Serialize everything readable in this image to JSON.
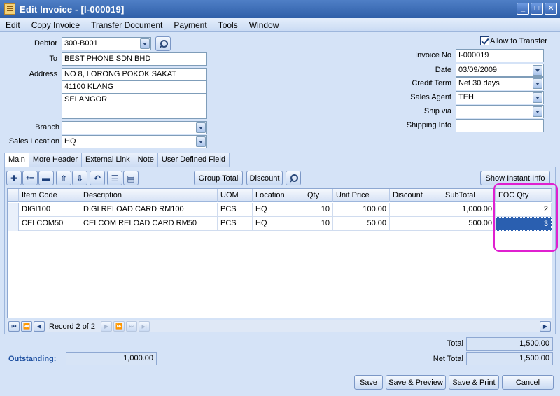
{
  "window": {
    "title": "Edit Invoice - [I-000019]",
    "controls": {
      "minimize": "_",
      "maximize": "□",
      "close": "✕"
    }
  },
  "menu": [
    "Edit",
    "Copy Invoice",
    "Transfer Document",
    "Payment",
    "Tools",
    "Window"
  ],
  "header": {
    "debtor_label": "Debtor",
    "debtor_value": "300-B001",
    "to_label": "To",
    "to_value": "BEST PHONE SDN BHD",
    "address_label": "Address",
    "address_lines": [
      "NO 8, LORONG POKOK SAKAT",
      "41100 KLANG",
      "SELANGOR",
      ""
    ],
    "branch_label": "Branch",
    "branch_value": "",
    "sales_location_label": "Sales Location",
    "sales_location_value": "HQ",
    "allow_transfer_label": "Allow to Transfer",
    "invoice_no_label": "Invoice No",
    "invoice_no_value": "I-000019",
    "date_label": "Date",
    "date_value": "03/09/2009",
    "credit_term_label": "Credit Term",
    "credit_term_value": "Net 30 days",
    "sales_agent_label": "Sales Agent",
    "sales_agent_value": "TEH",
    "ship_via_label": "Ship via",
    "ship_via_value": "",
    "shipping_info_label": "Shipping Info",
    "shipping_info_value": ""
  },
  "tabs": [
    "Main",
    "More Header",
    "External Link",
    "Note",
    "User Defined Field"
  ],
  "toolbar": {
    "group_total": "Group Total",
    "discount": "Discount",
    "show_instant_info": "Show Instant Info",
    "glyphs": {
      "add": "✚",
      "insert": "+═",
      "delete": "▬",
      "up": "⇧",
      "down": "⇩",
      "undo": "↶",
      "list": "☰",
      "detail": "▤"
    }
  },
  "grid": {
    "columns": [
      "Item Code",
      "Description",
      "UOM",
      "Location",
      "Qty",
      "Unit Price",
      "Discount",
      "SubTotal",
      "FOC Qty"
    ],
    "rows": [
      {
        "indicator": "",
        "item_code": "DIGI100",
        "description": "DIGI RELOAD CARD RM100",
        "uom": "PCS",
        "location": "HQ",
        "qty": "10",
        "unit_price": "100.00",
        "discount": "",
        "subtotal": "1,000.00",
        "foc_qty": "2"
      },
      {
        "indicator": "I",
        "item_code": "CELCOM50",
        "description": "CELCOM RELOAD CARD RM50",
        "uom": "PCS",
        "location": "HQ",
        "qty": "10",
        "unit_price": "50.00",
        "discount": "",
        "subtotal": "500.00",
        "foc_qty": "3"
      }
    ]
  },
  "navigator": {
    "record_text": "Record 2 of 2",
    "glyphs": {
      "first": "⏮",
      "prev_page": "⏪",
      "prev": "◀",
      "next": "▶",
      "next_page": "⏩",
      "last": "⏭",
      "end": "▶|",
      "scroll_right": "▶"
    }
  },
  "totals": {
    "total_label": "Total",
    "total_value": "1,500.00",
    "outstanding_label": "Outstanding:",
    "outstanding_value": "1,000.00",
    "net_total_label": "Net Total",
    "net_total_value": "1,500.00"
  },
  "actions": {
    "save": "Save",
    "save_preview": "Save & Preview",
    "save_print": "Save & Print",
    "cancel": "Cancel"
  },
  "colors": {
    "accent": "#2a5fb0",
    "highlight_box": "#e020d0",
    "outstanding_label": "#1d4fa0"
  }
}
